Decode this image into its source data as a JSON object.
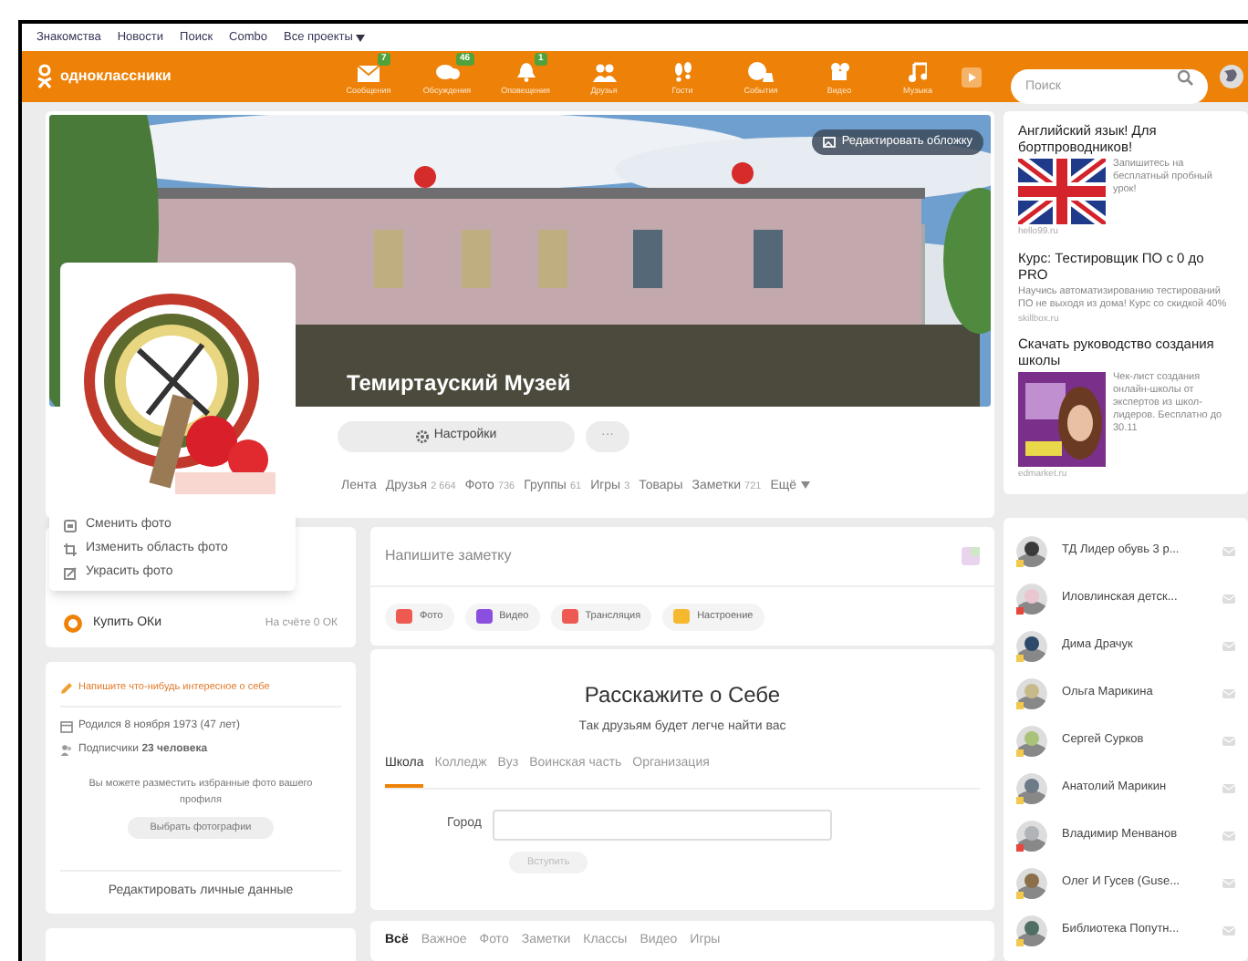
{
  "top_links": [
    {
      "label": "Знакомства"
    },
    {
      "label": "Новости"
    },
    {
      "label": "Поиск"
    },
    {
      "label": "Combo"
    },
    {
      "label": "Все проекты"
    }
  ],
  "logo": "одноклассники",
  "nav": [
    {
      "label": "Сообщения",
      "badge": "7"
    },
    {
      "label": "Обсуждения",
      "badge": "46"
    },
    {
      "label": "Оповещения",
      "badge": "1"
    },
    {
      "label": "Друзья"
    },
    {
      "label": "Гости"
    },
    {
      "label": "События"
    },
    {
      "label": "Видео"
    },
    {
      "label": "Музыка"
    }
  ],
  "search": {
    "placeholder": "Поиск"
  },
  "cover": {
    "edit_button": "Редактировать обложку",
    "name": "Темиртауский Музей"
  },
  "profile_buttons": {
    "settings": "Настройки",
    "more": "···"
  },
  "profile_tabs": [
    {
      "label": "Лента"
    },
    {
      "label": "Друзья",
      "count": "2 664"
    },
    {
      "label": "Фото",
      "count": "736"
    },
    {
      "label": "Группы",
      "count": "61"
    },
    {
      "label": "Игры",
      "count": "3"
    },
    {
      "label": "Товары"
    },
    {
      "label": "Заметки",
      "count": "721"
    },
    {
      "label": "Ещё"
    }
  ],
  "photo_menu": [
    {
      "label": "Сменить фото"
    },
    {
      "label": "Изменить область фото"
    },
    {
      "label": "Украсить фото"
    }
  ],
  "wallet": {
    "label": "Купить ОКи",
    "balance": "На счёте 0 ОК"
  },
  "about": {
    "prompt": "Напишите что-нибудь интересное о себе",
    "born": "Родился 8 ноября 1973 (47 лет)",
    "followers": "Подписчики **23 человека**",
    "photos_hint": "Вы можете разместить избранные фото вашего профиля",
    "photos_button": "Выбрать фотографии",
    "edit_link": "Редактировать личные данные"
  },
  "note": {
    "placeholder": "Напишите заметку",
    "actions": [
      {
        "label": "Фото",
        "color": "#ee5a52"
      },
      {
        "label": "Видео",
        "color": "#8b4fe0"
      },
      {
        "label": "Трансляция",
        "color": "#ee5a52"
      },
      {
        "label": "Настроение",
        "color": "#f5b82e"
      }
    ]
  },
  "tell": {
    "title": "Расскажите о Себе",
    "subtitle": "Так друзьям будет легче найти вас",
    "tabs": [
      {
        "label": "Школа",
        "selected": true
      },
      {
        "label": "Колледж",
        "selected": false
      },
      {
        "label": "Вуз",
        "selected": false
      },
      {
        "label": "Воинская часть",
        "selected": false
      },
      {
        "label": "Организация",
        "selected": false
      }
    ],
    "city_label": "Город",
    "join_button": "Вступить",
    "join_disabled": true
  },
  "feed_tabs": [
    {
      "label": "Всё",
      "selected": true
    },
    {
      "label": "Важное",
      "selected": false
    },
    {
      "label": "Фото",
      "selected": false
    },
    {
      "label": "Заметки",
      "selected": false
    },
    {
      "label": "Классы",
      "selected": false
    },
    {
      "label": "Видео",
      "selected": false
    },
    {
      "label": "Игры",
      "selected": false
    }
  ],
  "ads": [
    {
      "kind": "picture_right",
      "title": "Английский язык! Для бортпроводников!",
      "text": "Запишитесь на бесплатный пробный урок!",
      "domain": "hello99.ru"
    },
    {
      "kind": "text",
      "title": "Курс: Тестировщик ПО с 0 до PRO",
      "text": "Научись автоматизированию тестирований ПО не выходя из дома! Курс со скидкой 40%",
      "domain": "skillbox.ru"
    },
    {
      "kind": "picture_right",
      "title": "Скачать руководство создания школы",
      "text": "Чек-лист создания онлайн-школы от экспертов из школ-лидеров. Бесплатно до 30.11",
      "domain": "edmarket.ru"
    }
  ],
  "friends": [
    {
      "name": "ТД Лидер обувь 3 р...",
      "color": "#f2c94c"
    },
    {
      "name": "Иловлинская детск...",
      "color": "#e8453c"
    },
    {
      "name": "Дима Драчук",
      "color": "#f2c94c"
    },
    {
      "name": "Ольга Марикина",
      "color": "#f2c94c"
    },
    {
      "name": "Сергей Сурков",
      "color": "#f2c94c"
    },
    {
      "name": "Анатолий Марикин",
      "color": "#f2c94c"
    },
    {
      "name": "Владимир Менванов",
      "color": "#e8453c"
    },
    {
      "name": "Олег И Гусев (Guse...",
      "color": "#f2c94c"
    },
    {
      "name": "Библиотека Попутн...",
      "color": "#f2c94c"
    }
  ]
}
